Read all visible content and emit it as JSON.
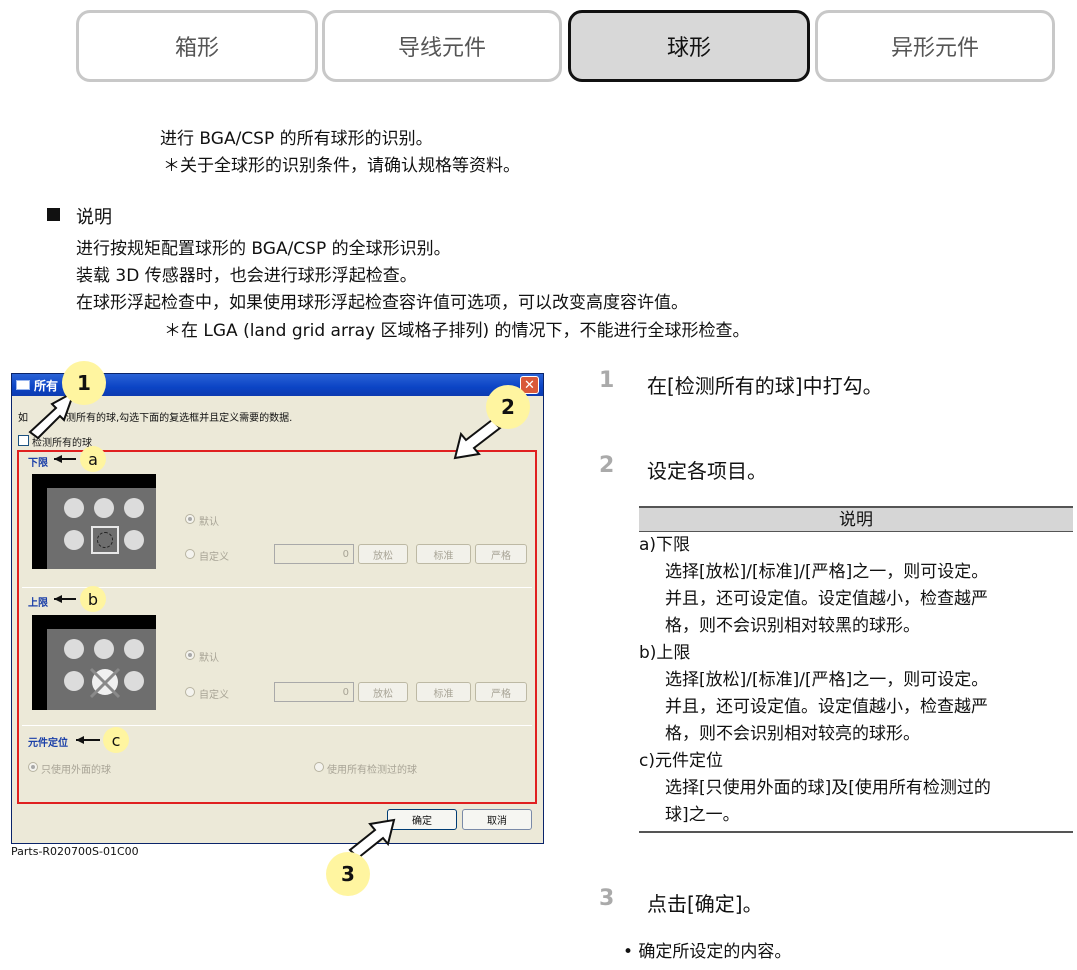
{
  "tabs": [
    "箱形",
    "导线元件",
    "球形",
    "异形元件"
  ],
  "intro": {
    "line1": "进行 BGA/CSP 的所有球形的识别。",
    "line2": "＊关于全球形的识别条件，请确认规格等资料。"
  },
  "section": {
    "title": "说明",
    "lines": [
      "进行按规矩配置球形的 BGA/CSP 的全球形识别。",
      "装载 3D 传感器时，也会进行球形浮起检查。",
      "在球形浮起检查中，如果使用球形浮起检查容许值可选项，可以改变高度容许值。"
    ],
    "note": "＊在 LGA (land grid array  区域格子排列) 的情况下，不能进行全球形检查。"
  },
  "dialog": {
    "title": "所有",
    "instruction_a": "如",
    "instruction_b": "测所有的球,勾选下面的复选框并且定义需要的数据.",
    "checkbox_label": "检测所有的球",
    "lower": {
      "title": "下限",
      "radio_default": "默认",
      "radio_custom": "自定义",
      "value": "0",
      "btn_loose": "放松",
      "btn_standard": "标准",
      "btn_strict": "严格"
    },
    "upper": {
      "title": "上限",
      "radio_default": "默认",
      "radio_custom": "自定义",
      "value": "0",
      "btn_loose": "放松",
      "btn_standard": "标准",
      "btn_strict": "严格"
    },
    "locate": {
      "title": "元件定位",
      "radio_outer": "只使用外面的球",
      "radio_all": "使用所有检测过的球"
    },
    "ok": "确定",
    "cancel": "取消",
    "caption": "Parts-R020700S-01C00"
  },
  "callouts": {
    "c1": "1",
    "c2": "2",
    "c3": "3",
    "a": "a",
    "b": "b",
    "c": "c"
  },
  "steps": {
    "s1": {
      "num": "1",
      "text": "在[检测所有的球]中打勾。"
    },
    "s2": {
      "num": "2",
      "text": "设定各项目。"
    },
    "s3": {
      "num": "3",
      "text": "点击[确定]。"
    }
  },
  "desc": {
    "header": "说明",
    "lines": [
      "a)下限",
      "选择[放松]/[标准]/[严格]之一，则可设定。",
      "并且，还可设定值。设定值越小，检查越严",
      "格，则不会识别相对较黑的球形。",
      "b)上限",
      "选择[放松]/[标准]/[严格]之一，则可设定。",
      "并且，还可设定值。设定值越小，检查越严",
      "格，则不会识别相对较亮的球形。",
      "c)元件定位",
      "选择[只使用外面的球]及[使用所有检测过的",
      "球]之一。"
    ]
  },
  "confirm_note": "• 确定所设定的内容。"
}
